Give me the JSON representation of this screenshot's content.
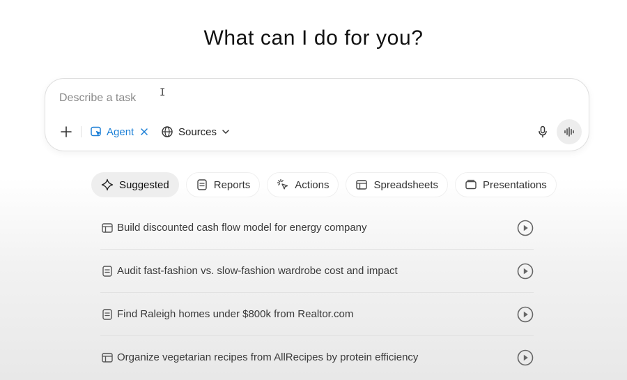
{
  "heading": "What can I do for you?",
  "composer": {
    "placeholder": "Describe a task",
    "caret": "I",
    "agent_label": "Agent",
    "sources_label": "Sources",
    "accent_color": "#1b7fd6"
  },
  "tabs": [
    {
      "label": "Suggested",
      "icon": "sparkle-icon",
      "active": true
    },
    {
      "label": "Reports",
      "icon": "document-icon"
    },
    {
      "label": "Actions",
      "icon": "cursor-click-icon"
    },
    {
      "label": "Spreadsheets",
      "icon": "table-icon"
    },
    {
      "label": "Presentations",
      "icon": "presentation-icon"
    }
  ],
  "tasks": [
    {
      "label": "Build discounted cash flow model for energy company",
      "icon": "table-icon"
    },
    {
      "label": "Audit fast-fashion vs. slow-fashion wardrobe cost and impact",
      "icon": "document-icon"
    },
    {
      "label": "Find Raleigh homes under $800k from Realtor.com",
      "icon": "document-icon"
    },
    {
      "label": "Organize vegetarian recipes from AllRecipes by protein efficiency",
      "icon": "table-icon"
    }
  ]
}
